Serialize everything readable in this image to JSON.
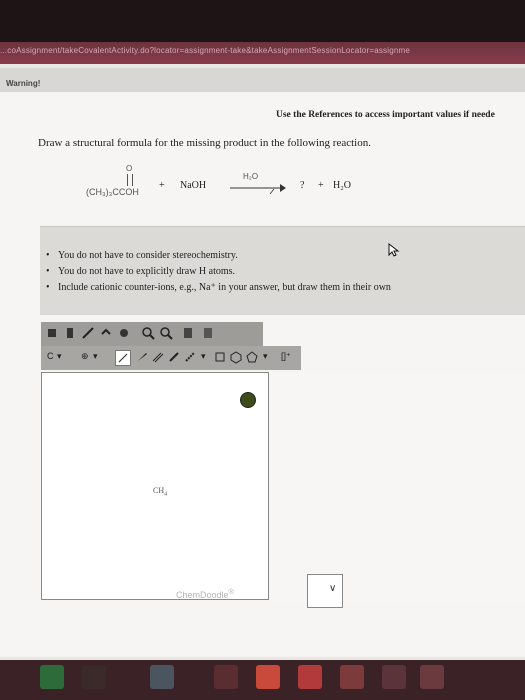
{
  "browser": {
    "url": "...coAssignment/takeCovalentActivity.do?locator=assignment-take&takeAssignmentSessionLocator=assignme"
  },
  "warning": "Warning!",
  "references": "Use the References to access important values if neede",
  "question": "Draw a structural formula for the missing product in the following reaction.",
  "reaction": {
    "carbonyl_o": "O",
    "acid": "(CH₃)₃CCOH",
    "plus1": "+",
    "reagent": "NaOH",
    "above_arrow": "H₂O",
    "missing": "?",
    "plus2": "+",
    "byproduct": "H₂O"
  },
  "notes": [
    "You do not have to consider stereochemistry.",
    "You do not have to explicitly draw H atoms.",
    "Include cationic counter-ions, e.g., Na⁺ in your answer, but draw them in their own"
  ],
  "toolbar2": {
    "carbon": "C",
    "charge": "⊕",
    "chev": "▾",
    "ring_chev": "▾",
    "bracket": "[]⁺"
  },
  "canvas": {
    "ch4_label": "CH",
    "ch4_sub": "4",
    "watermark": "ChemDoodle",
    "watermark_mark": "®",
    "select_chev": "∨"
  },
  "icons": [
    "eraser-icon",
    "lasso-icon",
    "pencil-icon",
    "undo-icon",
    "zoom-in-icon",
    "zoom-out-icon",
    "clean-icon",
    "label-icon",
    "help-icon",
    "cursor-icon"
  ],
  "colors": {
    "urlbar": "#7a3845",
    "screen": "#f6f5f3",
    "notes_bg": "#dcdad6",
    "toolbar": "#9e9c98",
    "help_btn": "#3f4b18",
    "taskbar": "#3a2226"
  }
}
